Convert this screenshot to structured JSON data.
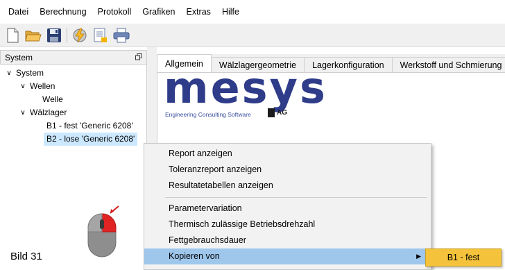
{
  "menubar": {
    "items": [
      "Datei",
      "Berechnung",
      "Protokoll",
      "Grafiken",
      "Extras",
      "Hilfe"
    ]
  },
  "toolbar": {
    "buttons": [
      "new-document-icon",
      "open-folder-icon",
      "save-disk-icon",
      "calculate-lightning-icon",
      "report-icon",
      "print-icon"
    ]
  },
  "panel": {
    "title": "System"
  },
  "tree": {
    "system": "System",
    "wellen": "Wellen",
    "welle": "Welle",
    "waelzlager": "Wälzlager",
    "b1": "B1 - fest 'Generic 6208'",
    "b2": "B2 - lose 'Generic 6208'"
  },
  "tabs": [
    "Allgemein",
    "Wälzlagergeometrie",
    "Lagerkonfiguration",
    "Werkstoff und Schmierung"
  ],
  "logo": {
    "name": "mesys",
    "subtitle": "Engineering Consulting Software",
    "suffix": "AG"
  },
  "context_menu": {
    "items": [
      "Report anzeigen",
      "Toleranzreport anzeigen",
      "Resultatetabellen anzeigen",
      "Parametervariation",
      "Thermisch zulässige Betriebsdrehzahl",
      "Fettgebrauchsdauer",
      "Kopieren von"
    ]
  },
  "submenu": {
    "item": "B1 - fest"
  },
  "caption": "Bild 31",
  "colors": {
    "selection": "#cce8ff",
    "menu_highlight": "#9fc7ec",
    "submenu_highlight": "#f5c33b",
    "logo_blue": "#2f3c8a",
    "mouse_button_red": "#e02424"
  }
}
